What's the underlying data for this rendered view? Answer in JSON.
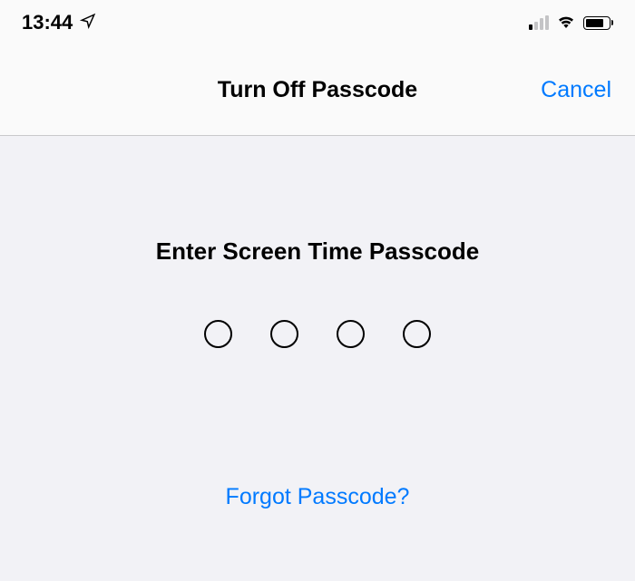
{
  "statusBar": {
    "time": "13:44"
  },
  "navHeader": {
    "title": "Turn Off Passcode",
    "cancel": "Cancel"
  },
  "content": {
    "prompt": "Enter Screen Time Passcode",
    "forgot": "Forgot Passcode?"
  }
}
